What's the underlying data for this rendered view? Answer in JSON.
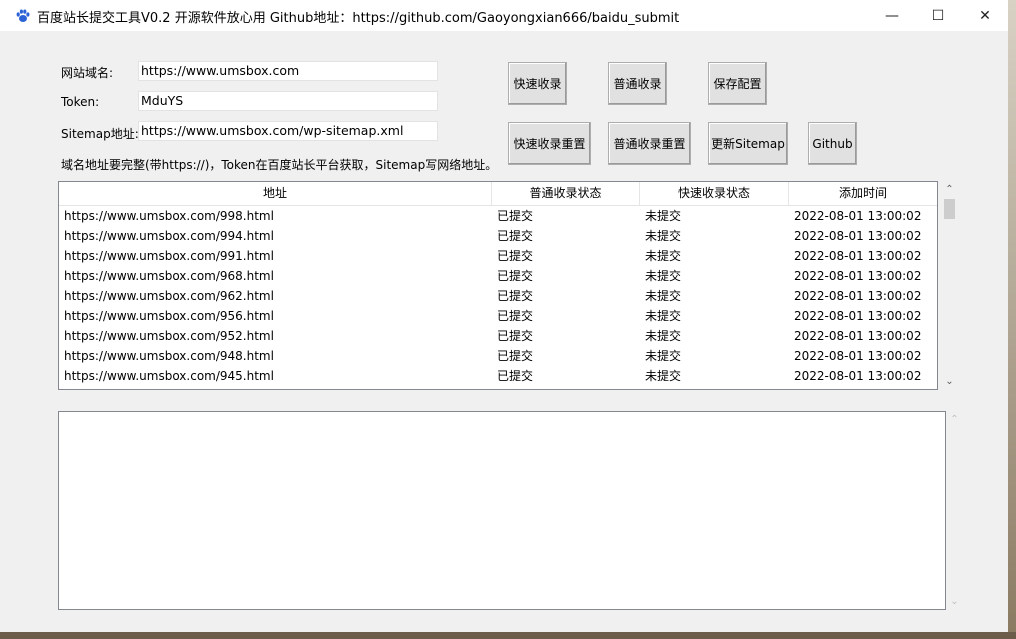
{
  "window": {
    "title": "百度站长提交工具V0.2 开源软件放心用 Github地址：https://github.com/Gaoyongxian666/baidu_submit",
    "app_icon": "baidu-paw-icon",
    "minimize_glyph": "—",
    "maximize_glyph": "☐",
    "close_glyph": "✕"
  },
  "form": {
    "domain_label": "网站域名:",
    "domain_value": "https://www.umsbox.com",
    "token_label": "Token:",
    "token_value": "MduYS",
    "sitemap_label": "Sitemap地址:",
    "sitemap_value": "https://www.umsbox.com/wp-sitemap.xml",
    "hint": "域名地址要完整(带https://)，Token在百度站长平台获取，Sitemap写网络地址。"
  },
  "buttons": {
    "fast_submit": "快速收录",
    "normal_submit": "普通收录",
    "save_config": "保存配置",
    "fast_reset": "快速收录重置",
    "normal_reset": "普通收录重置",
    "update_sitemap": "更新Sitemap",
    "github": "Github"
  },
  "table": {
    "columns": [
      "地址",
      "普通收录状态",
      "快速收录状态",
      "添加时间"
    ],
    "rows": [
      [
        "https://www.umsbox.com/998.html",
        "已提交",
        "未提交",
        "2022-08-01 13:00:02"
      ],
      [
        "https://www.umsbox.com/994.html",
        "已提交",
        "未提交",
        "2022-08-01 13:00:02"
      ],
      [
        "https://www.umsbox.com/991.html",
        "已提交",
        "未提交",
        "2022-08-01 13:00:02"
      ],
      [
        "https://www.umsbox.com/968.html",
        "已提交",
        "未提交",
        "2022-08-01 13:00:02"
      ],
      [
        "https://www.umsbox.com/962.html",
        "已提交",
        "未提交",
        "2022-08-01 13:00:02"
      ],
      [
        "https://www.umsbox.com/956.html",
        "已提交",
        "未提交",
        "2022-08-01 13:00:02"
      ],
      [
        "https://www.umsbox.com/952.html",
        "已提交",
        "未提交",
        "2022-08-01 13:00:02"
      ],
      [
        "https://www.umsbox.com/948.html",
        "已提交",
        "未提交",
        "2022-08-01 13:00:02"
      ],
      [
        "https://www.umsbox.com/945.html",
        "已提交",
        "未提交",
        "2022-08-01 13:00:02"
      ]
    ]
  },
  "scroll": {
    "up": "⌃",
    "down": "⌄"
  },
  "log": {
    "content": ""
  },
  "colors": {
    "window_bg": "#f0f0f0",
    "button_bg": "#e1e1e1",
    "border": "#828790",
    "icon_blue": "#2b62d6"
  }
}
